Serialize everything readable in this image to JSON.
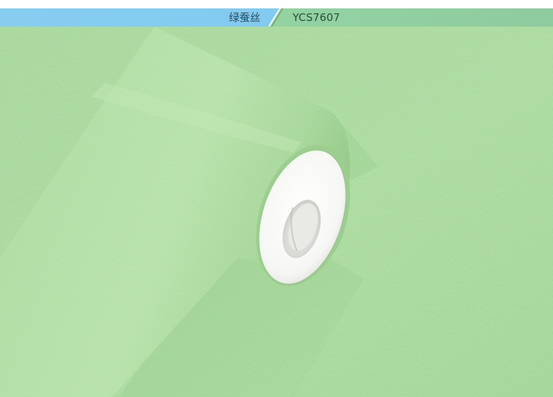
{
  "header": {
    "color_name": "绿蚕丝",
    "model_code": "YCS7607"
  },
  "colors": {
    "header_left": "#86cdf0",
    "header_right": "#93d3a2",
    "wallpaper_green": "#a8d89a",
    "roll_core": "#ffffff"
  },
  "image": {
    "subject": "wallpaper-roll-icon"
  }
}
